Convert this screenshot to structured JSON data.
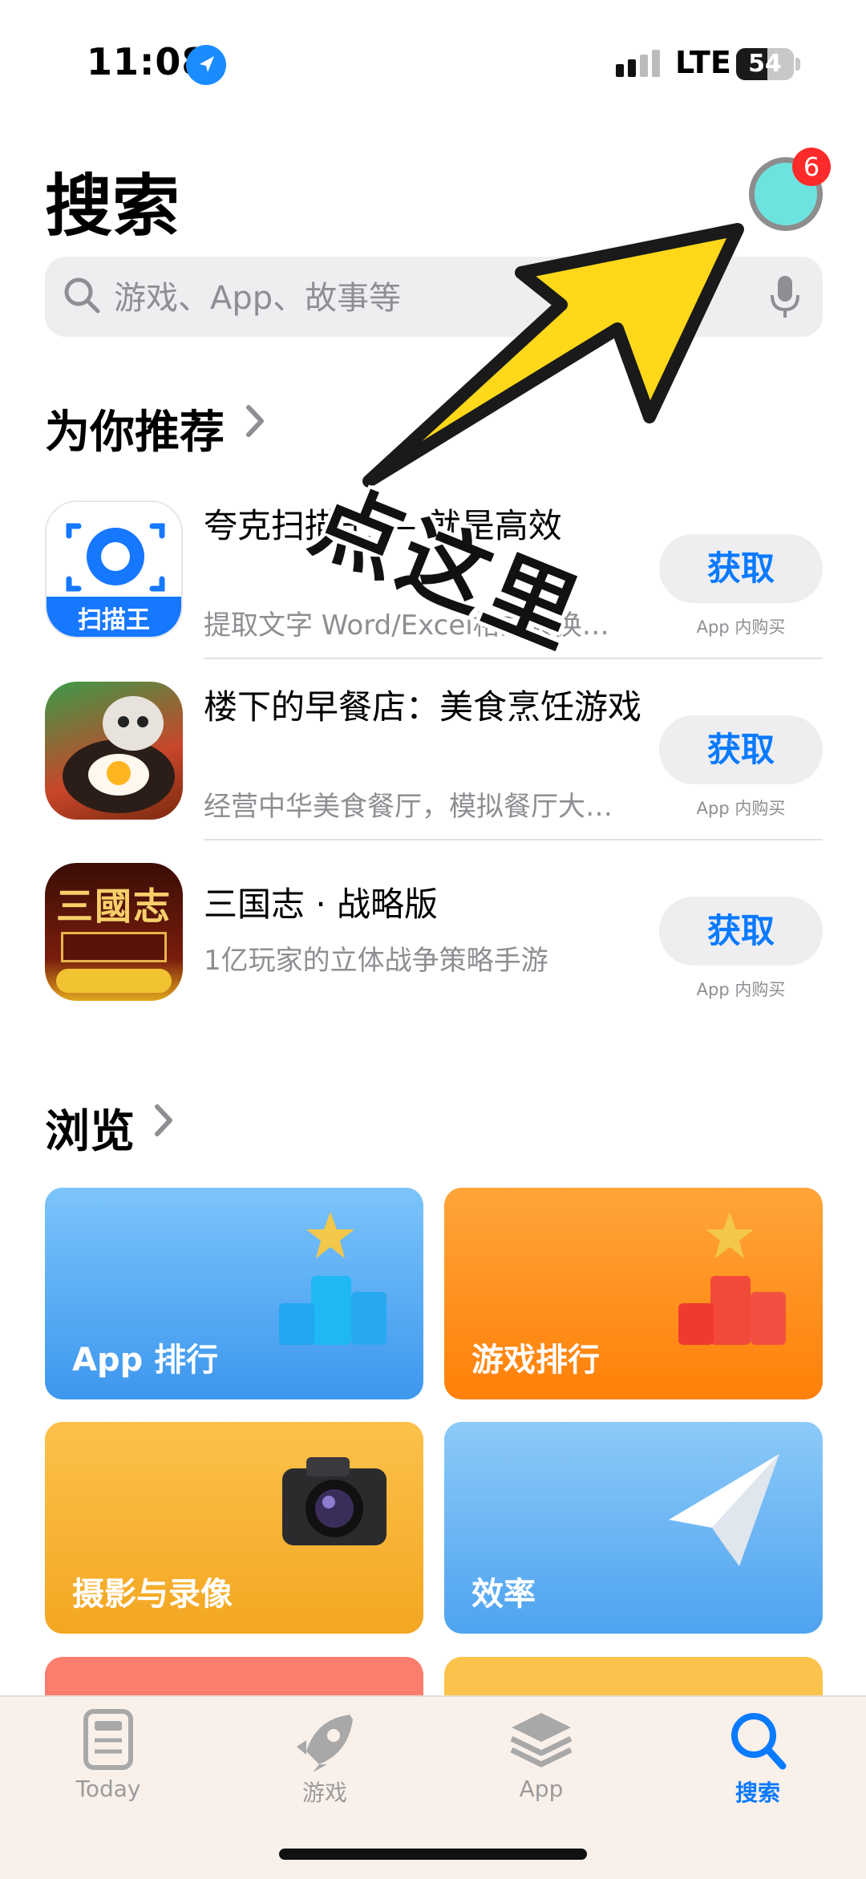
{
  "status_bar": {
    "time": "11:08",
    "network": "LTE",
    "battery": "54",
    "battery_level": 0.54
  },
  "header": {
    "title": "搜索",
    "notification_count": "6"
  },
  "search": {
    "placeholder": "游戏、App、故事等"
  },
  "recommended": {
    "title": "为你推荐",
    "apps": [
      {
        "title": "夸克扫描王 — 就是高效",
        "subtitle": "提取文字 Word/Excel格式转换…",
        "button": "获取",
        "note": "App 内购买",
        "icon_text": "扫描王"
      },
      {
        "title": "楼下的早餐店：美食烹饪游戏",
        "subtitle": "经营中华美食餐厅，模拟餐厅大…",
        "button": "获取",
        "note": "App 内购买",
        "icon_text": ""
      },
      {
        "title": "三国志 · 战略版",
        "subtitle": "1亿玩家的立体战争策略手游",
        "button": "获取",
        "note": "App 内购买",
        "icon_text": "三國志"
      }
    ]
  },
  "browse": {
    "title": "浏览",
    "tiles": [
      {
        "label": "App 排行",
        "color": "#4aa8f5"
      },
      {
        "label": "游戏排行",
        "color": "#ff8c1a"
      },
      {
        "label": "摄影与录像",
        "color": "#f5b23a"
      },
      {
        "label": "效率",
        "color": "#5aacf5"
      }
    ]
  },
  "tabbar": {
    "tabs": [
      {
        "label": "Today",
        "icon": "today-icon"
      },
      {
        "label": "游戏",
        "icon": "rocket-icon"
      },
      {
        "label": "App",
        "icon": "layers-icon"
      },
      {
        "label": "搜索",
        "icon": "search-icon",
        "active": true
      }
    ]
  },
  "overlay": {
    "text": "点这里"
  }
}
